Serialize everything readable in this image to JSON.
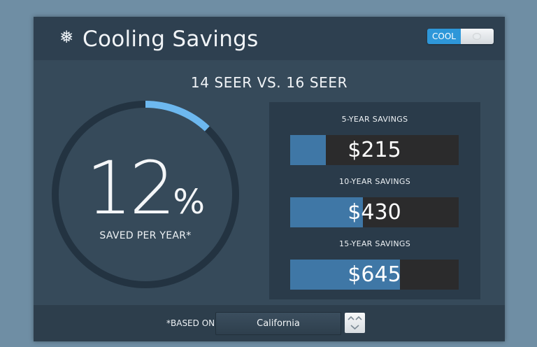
{
  "header": {
    "title": "Cooling Savings",
    "icon": "snowflake-icon",
    "toggle_label": "COOL"
  },
  "comparison": "14 SEER VS. 16 SEER",
  "gauge": {
    "percent_value": "12",
    "percent_sign": "%",
    "saved_label": "SAVED PER YEAR*",
    "fraction": 0.12,
    "track_color": "#233341",
    "fill_color": "#6db8ef"
  },
  "savings": [
    {
      "label": "5-YEAR SAVINGS",
      "value": "$215",
      "fill_fraction": 0.21
    },
    {
      "label": "10-YEAR SAVINGS",
      "value": "$430",
      "fill_fraction": 0.43
    },
    {
      "label": "15-YEAR SAVINGS",
      "value": "$645",
      "fill_fraction": 0.65
    }
  ],
  "footer": {
    "based_on_label": "*BASED ON",
    "region_value": "California"
  },
  "colors": {
    "accent": "#2e97d9",
    "bar_fill": "#3f77a6",
    "bar_track": "#2b2b2c"
  }
}
